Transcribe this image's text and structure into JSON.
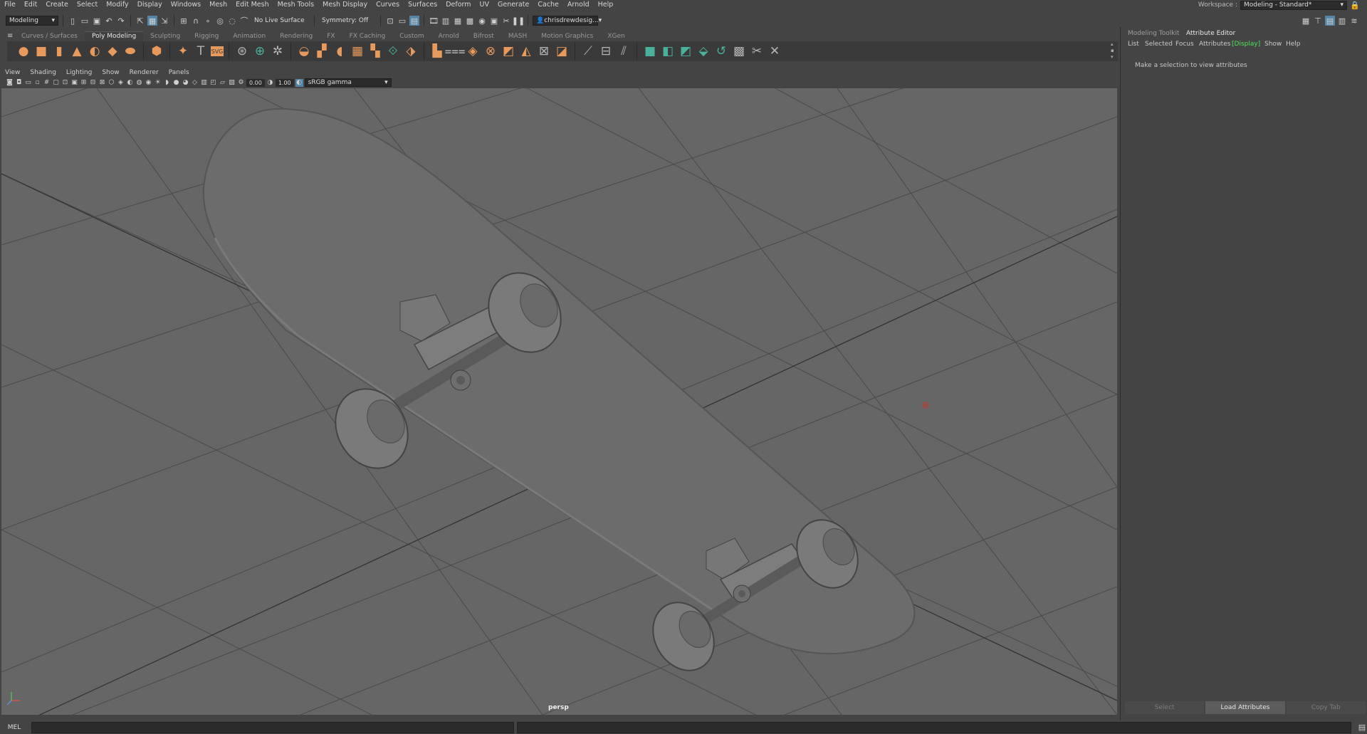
{
  "menubar": {
    "items": [
      "File",
      "Edit",
      "Create",
      "Select",
      "Modify",
      "Display",
      "Windows",
      "Mesh",
      "Edit Mesh",
      "Mesh Tools",
      "Mesh Display",
      "Curves",
      "Surfaces",
      "Deform",
      "UV",
      "Generate",
      "Cache",
      "Arnold",
      "Help"
    ]
  },
  "workspace": {
    "label": "Workspace :",
    "value": "Modeling - Standard*"
  },
  "statusline": {
    "mode": "Modeling",
    "live_surface": "No Live Surface",
    "symmetry": "Symmetry: Off",
    "account": "chrisdrewdesig..."
  },
  "shelf": {
    "tabs": [
      "Curves / Surfaces",
      "Poly Modeling",
      "Sculpting",
      "Rigging",
      "Animation",
      "Rendering",
      "FX",
      "FX Caching",
      "Custom",
      "Arnold",
      "Bifrost",
      "MASH",
      "Motion Graphics",
      "XGen"
    ],
    "active_tab": "Poly Modeling",
    "text_tool": "T",
    "svg_tool": "SVG"
  },
  "panel": {
    "menus": [
      "View",
      "Shading",
      "Lighting",
      "Show",
      "Renderer",
      "Panels"
    ],
    "exposure": "0.00",
    "gamma": "1.00",
    "color_space": "sRGB gamma",
    "camera": "persp"
  },
  "right_panel": {
    "tabs": [
      "Modeling Toolkit",
      "Attribute Editor"
    ],
    "active_tab": "Attribute Editor",
    "menu": [
      "List",
      "Selected",
      "Focus",
      "Attributes",
      "[Display]",
      "Show",
      "Help"
    ],
    "empty_message": "Make a selection to view attributes",
    "buttons": [
      "Select",
      "Load Attributes",
      "Copy Tab"
    ]
  },
  "cmdline": {
    "label": "MEL"
  },
  "colors": {
    "viewport_bg": "#666666",
    "accent_orange": "#e89a5c",
    "display_green": "#4fe35c"
  }
}
